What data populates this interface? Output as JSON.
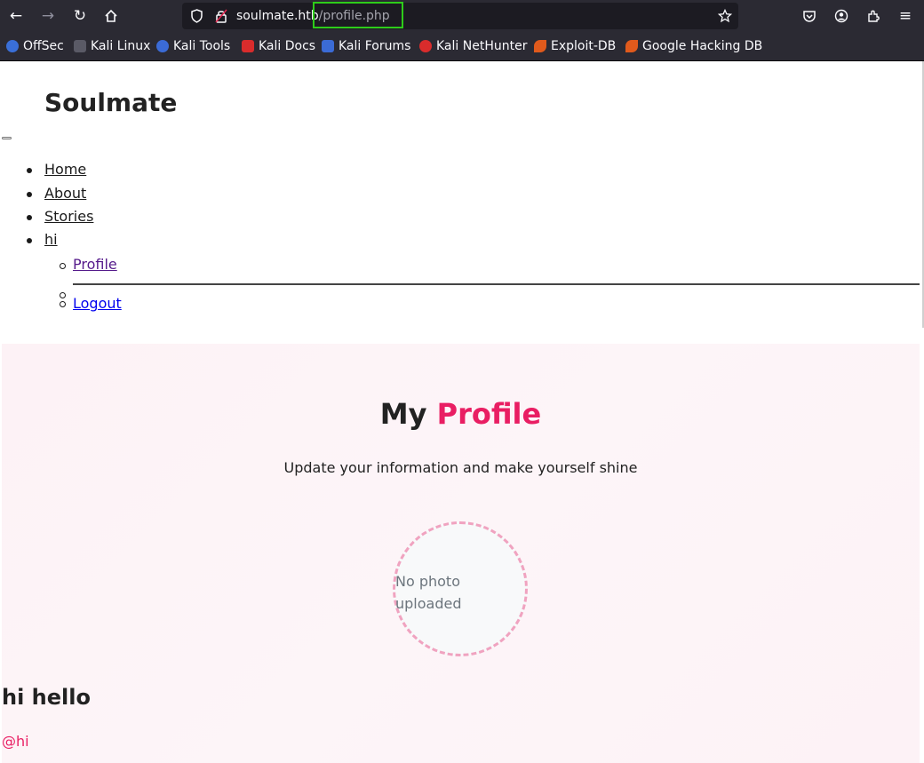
{
  "browser": {
    "url_host": "soulmate.htb",
    "url_path": "/profile.php",
    "bookmarks": [
      {
        "label": "OffSec",
        "color": "#3a6fd8"
      },
      {
        "label": "Kali Linux",
        "color": "#c9c9c9"
      },
      {
        "label": "Kali Tools",
        "color": "#3b6bd6"
      },
      {
        "label": "Kali Docs",
        "color": "#d92c2c"
      },
      {
        "label": "Kali Forums",
        "color": "#3b6bd6"
      },
      {
        "label": "Kali NetHunter",
        "color": "#d92c2c"
      },
      {
        "label": "Exploit-DB",
        "color": "#e05a1c"
      },
      {
        "label": "Google Hacking DB",
        "color": "#e05a1c"
      }
    ]
  },
  "site": {
    "brand": "Soulmate",
    "nav": {
      "home": "Home",
      "about": "About",
      "stories": "Stories",
      "user": "hi",
      "profile": "Profile",
      "logout": "Logout"
    }
  },
  "profile": {
    "title_plain": "My",
    "title_accent": "Profile",
    "subtitle": "Update your information and make yourself shine",
    "photo_placeholder": "No photo uploaded",
    "name": "hi hello",
    "handle": "@hi"
  },
  "colors": {
    "accent": "#e91e63",
    "highlight_box": "#2ecc1a"
  }
}
